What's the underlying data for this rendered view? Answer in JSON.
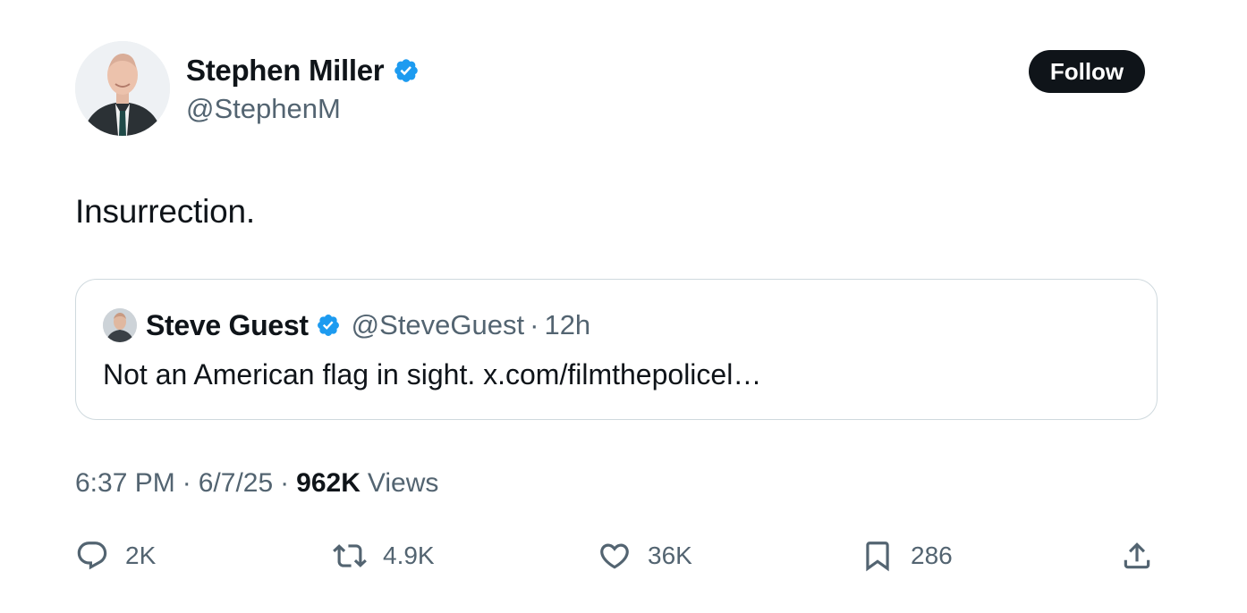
{
  "author": {
    "name": "Stephen Miller",
    "handle": "@StephenM",
    "verified_color": "#1d9bf0"
  },
  "follow_label": "Follow",
  "tweet_text": "Insurrection.",
  "quote": {
    "name": "Steve Guest",
    "handle": "@SteveGuest",
    "separator": "·",
    "time": "12h",
    "text": "Not an American flag in sight. x.com/filmthepolicel…"
  },
  "meta": {
    "time": "6:37 PM",
    "date": "6/7/25",
    "separator": "·",
    "views_count": "962K",
    "views_label": "Views"
  },
  "actions": {
    "replies": "2K",
    "reposts": "4.9K",
    "likes": "36K",
    "bookmarks": "286"
  },
  "icons": [
    "verified-badge-icon",
    "reply-icon",
    "repost-icon",
    "like-icon",
    "bookmark-icon",
    "share-icon"
  ]
}
